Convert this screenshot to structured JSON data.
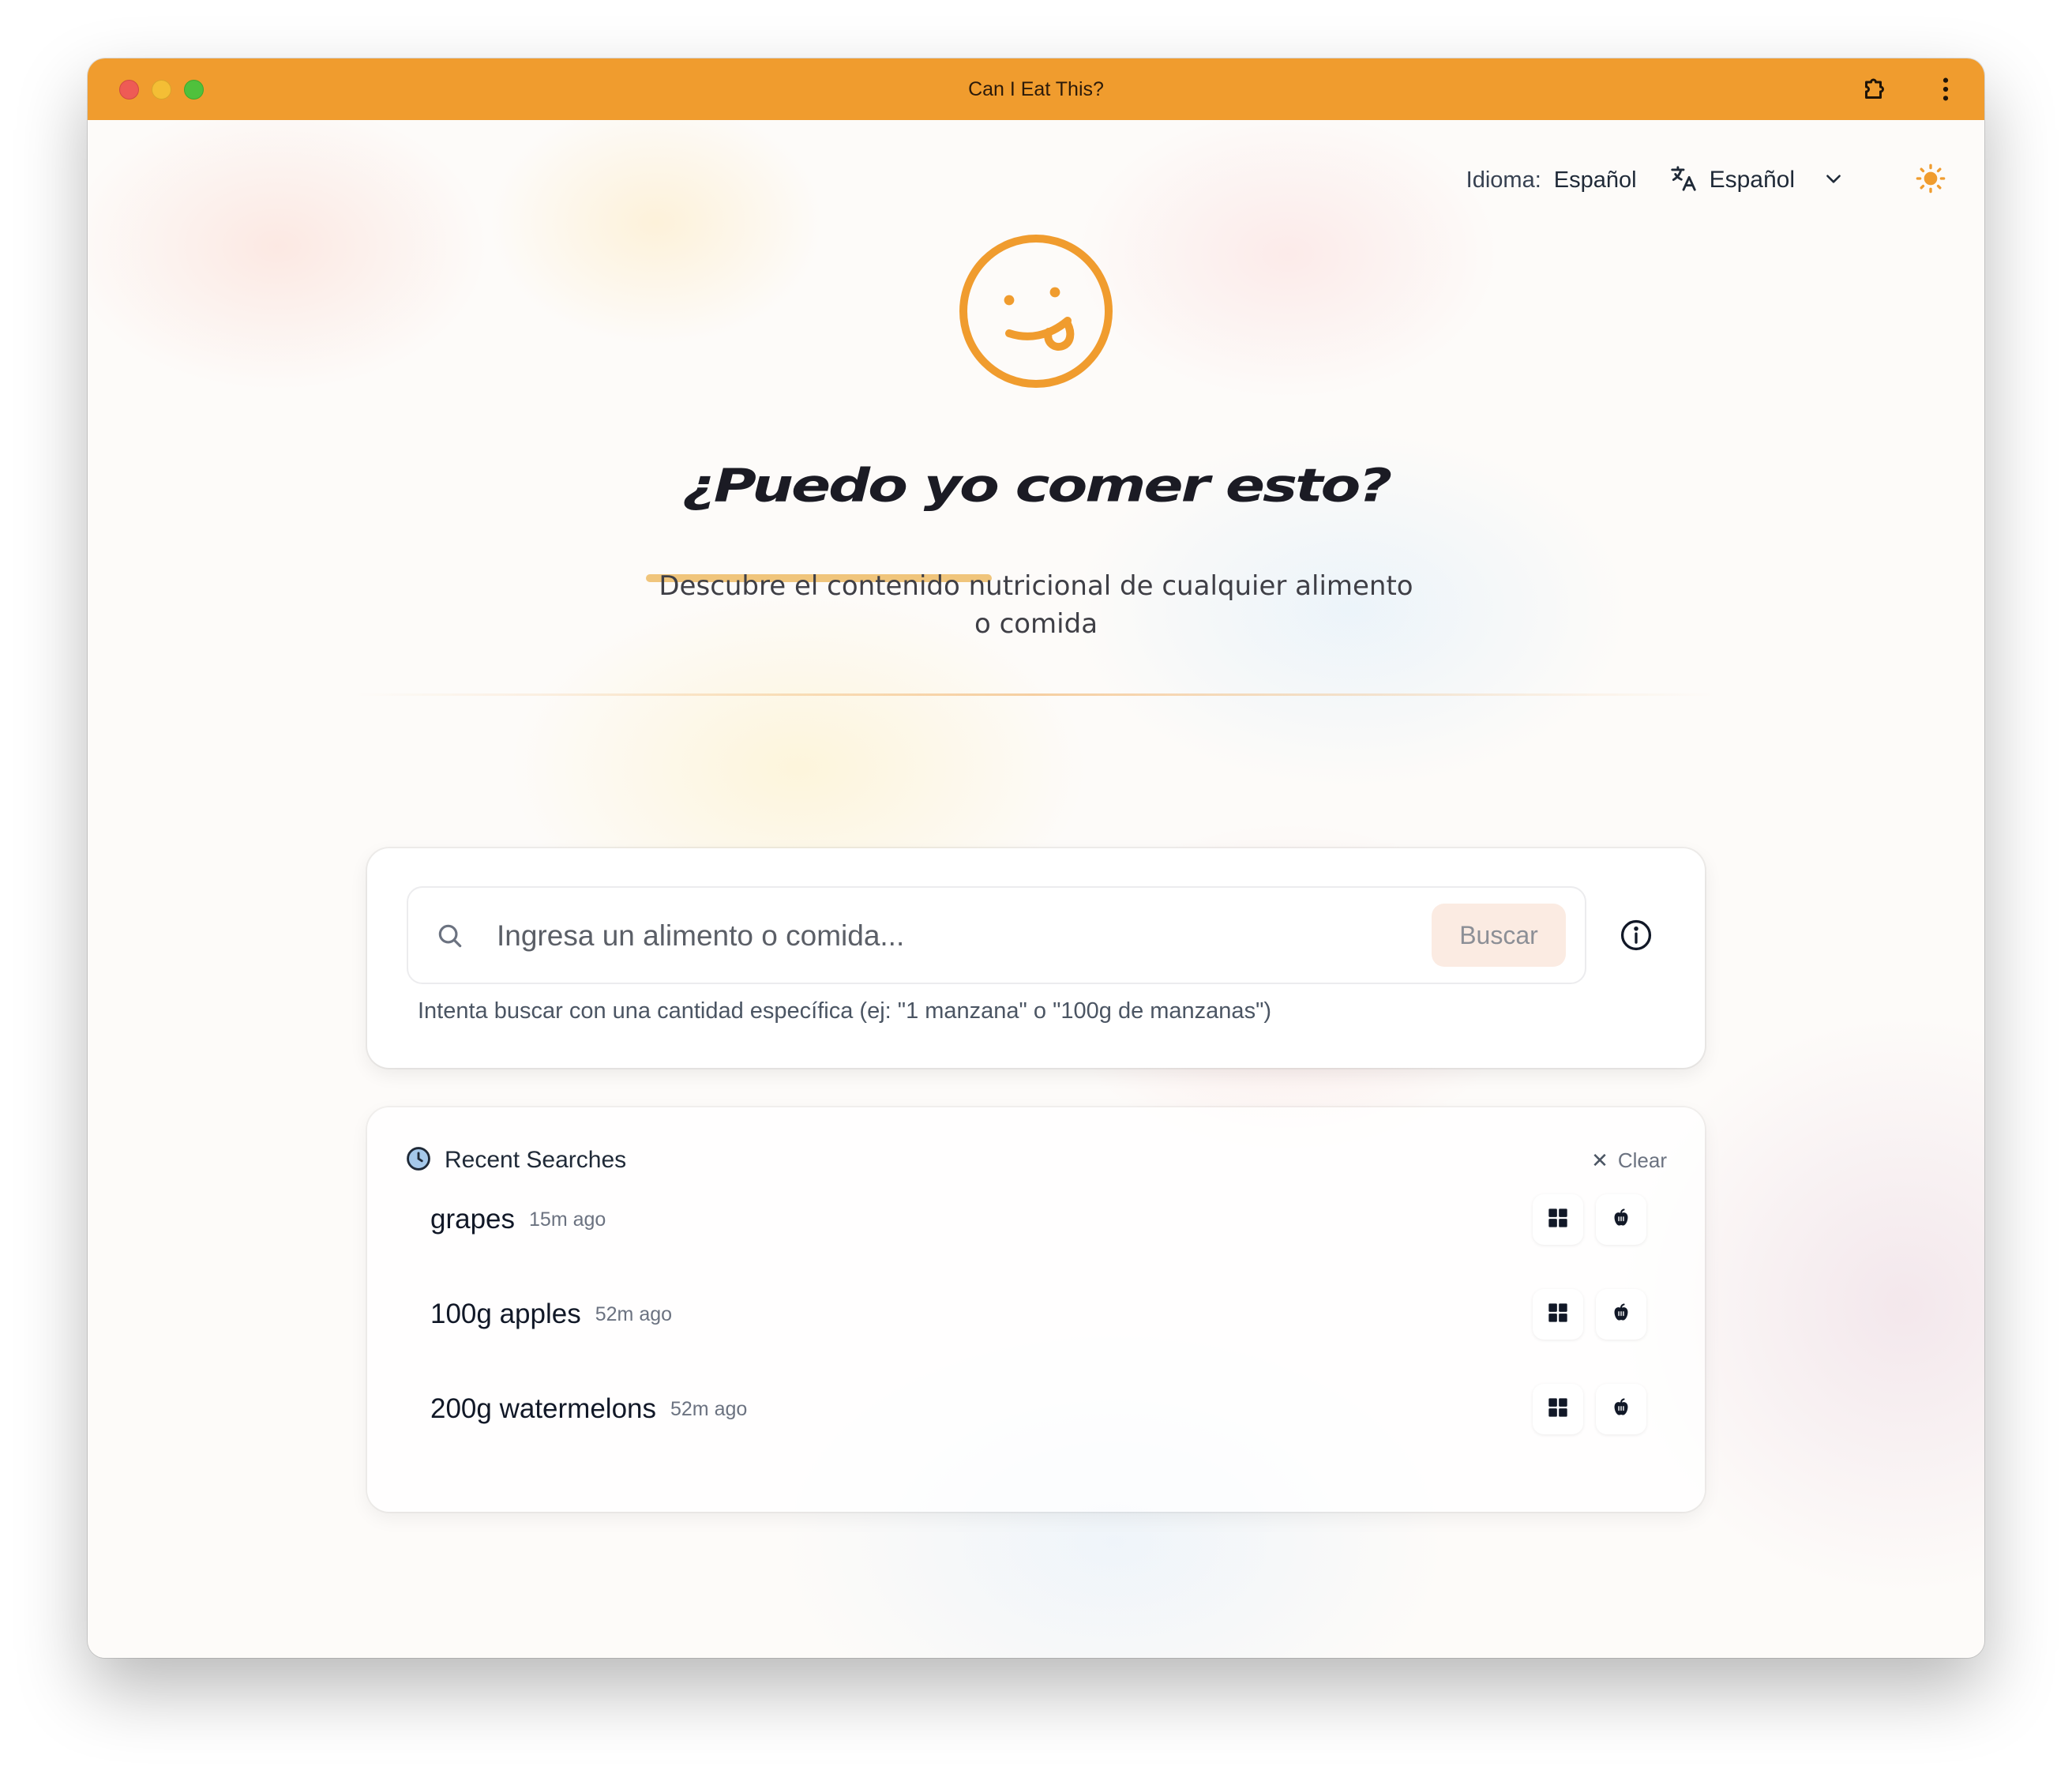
{
  "window": {
    "title": "Can I Eat This?"
  },
  "colors": {
    "accent": "#f09c2e",
    "title_bar": "#f09c2e",
    "underline": "#f0c57c",
    "button_bg": "#fbebe2"
  },
  "header": {
    "language_label": "Idioma:",
    "language_current": "Español",
    "language_select_value": "Español",
    "theme_icon": "sun-icon"
  },
  "hero": {
    "title": "¿Puedo yo comer esto?",
    "subtitle": "Descubre el contenido nutricional de cualquier alimento o comida"
  },
  "search": {
    "placeholder": "Ingresa un alimento o comida...",
    "value": "",
    "button_label": "Buscar",
    "hint": "Intenta buscar con una cantidad específica (ej: \"1 manzana\" o \"100g de manzanas\")"
  },
  "recent": {
    "title": "Recent Searches",
    "clear_label": "Clear",
    "items": [
      {
        "query": "grapes",
        "time": "15m ago"
      },
      {
        "query": "100g apples",
        "time": "52m ago"
      },
      {
        "query": "200g watermelons",
        "time": "52m ago"
      }
    ]
  }
}
